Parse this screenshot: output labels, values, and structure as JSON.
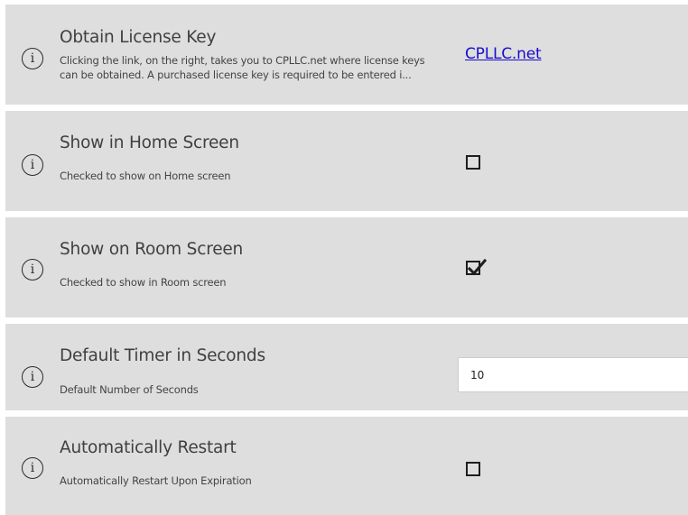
{
  "rows": [
    {
      "title": "Obtain License Key",
      "description_line1": "Clicking the link, on the right, takes you to CPLLC.net where license keys",
      "description_line2": "can be obtained.  A purchased license key is required to be entered i...",
      "link_text": "CPLLC.net"
    },
    {
      "title": "Show in Home Screen",
      "description": "Checked to show on Home screen",
      "checked": false
    },
    {
      "title": "Show on Room Screen",
      "description": "Checked to show in Room screen",
      "checked": true
    },
    {
      "title": "Default Timer in Seconds",
      "description": "Default Number of Seconds",
      "value": "10"
    },
    {
      "title": "Automatically Restart",
      "description": "Automatically Restart Upon Expiration",
      "checked": false
    }
  ],
  "icons": {
    "info": "info-icon",
    "info_glyph": "i"
  }
}
